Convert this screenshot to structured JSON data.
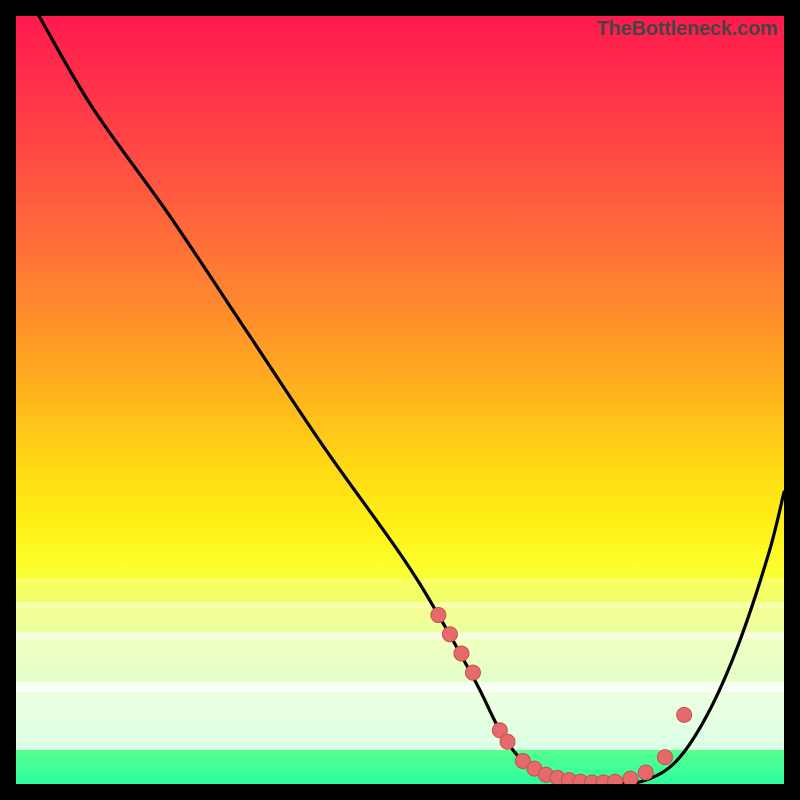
{
  "watermark": "TheBottleneck.com",
  "colors": {
    "background": "#000000",
    "gradient_top": "#ff1a4d",
    "gradient_bottom": "#2bff9e",
    "curve_stroke": "#000000",
    "dot_fill": "#e66a6a",
    "dot_stroke": "#c84f4f"
  },
  "chart_data": {
    "type": "line",
    "title": "",
    "xlabel": "",
    "ylabel": "",
    "ylim": [
      0,
      100
    ],
    "xlim": [
      0,
      100
    ],
    "series": [
      {
        "name": "bottleneck-curve",
        "x": [
          3,
          10,
          20,
          30,
          40,
          50,
          55,
          60,
          63,
          66,
          70,
          74,
          78,
          82,
          86,
          90,
          94,
          98,
          100
        ],
        "values": [
          100,
          88,
          74,
          59,
          44,
          30,
          22,
          13,
          7,
          3,
          0.5,
          0,
          0,
          0.5,
          3,
          9,
          18,
          30,
          38
        ]
      }
    ],
    "markers": {
      "name": "highlighted-points",
      "x": [
        55,
        56.5,
        58,
        59.5,
        63,
        64,
        66,
        67.5,
        69,
        70.5,
        72,
        73.5,
        75,
        76.5,
        78,
        80,
        82,
        84.5,
        87
      ],
      "values": [
        22,
        19.5,
        17,
        14.5,
        7,
        5.5,
        3,
        2,
        1.2,
        0.8,
        0.5,
        0.3,
        0.2,
        0.2,
        0.3,
        0.7,
        1.5,
        3.5,
        9
      ]
    }
  }
}
